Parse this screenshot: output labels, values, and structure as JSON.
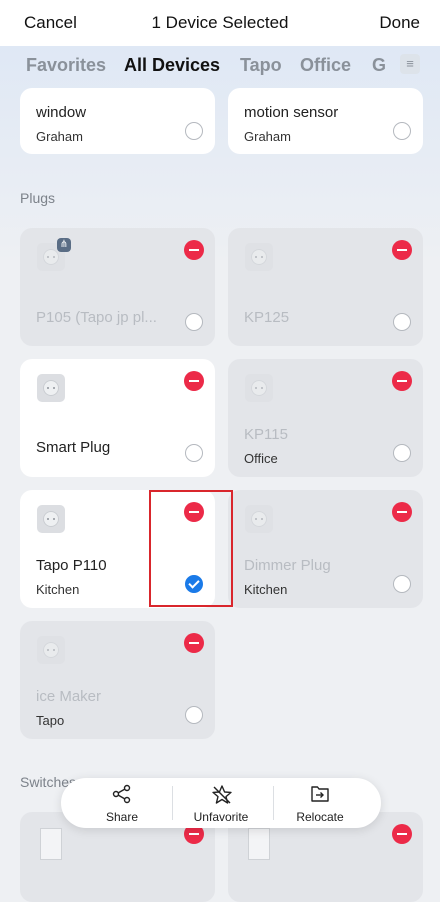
{
  "header": {
    "cancel": "Cancel",
    "title": "1 Device Selected",
    "done": "Done"
  },
  "tabs": [
    "Favorites",
    "All Devices",
    "Tapo",
    "Office",
    "G"
  ],
  "top_cards": [
    {
      "name": "window",
      "room": "Graham"
    },
    {
      "name": "motion sensor",
      "room": "Graham"
    }
  ],
  "sections": {
    "plugs": "Plugs",
    "switches": "Switches"
  },
  "plugs": [
    {
      "name": "P105 (Tapo jp pl...",
      "room": ""
    },
    {
      "name": "KP125",
      "room": ""
    },
    {
      "name": "Smart Plug",
      "room": ""
    },
    {
      "name": "KP115",
      "room": "Office"
    },
    {
      "name": "Tapo P110",
      "room": "Kitchen"
    },
    {
      "name": "Dimmer Plug",
      "room": "Kitchen"
    },
    {
      "name": "ice Maker",
      "room": "Tapo"
    }
  ],
  "actions": {
    "share": "Share",
    "unfavorite": "Unfavorite",
    "relocate": "Relocate"
  },
  "colors": {
    "accent": "#1a7ae8",
    "remove": "#ec2a48",
    "highlight": "#d9262c"
  }
}
